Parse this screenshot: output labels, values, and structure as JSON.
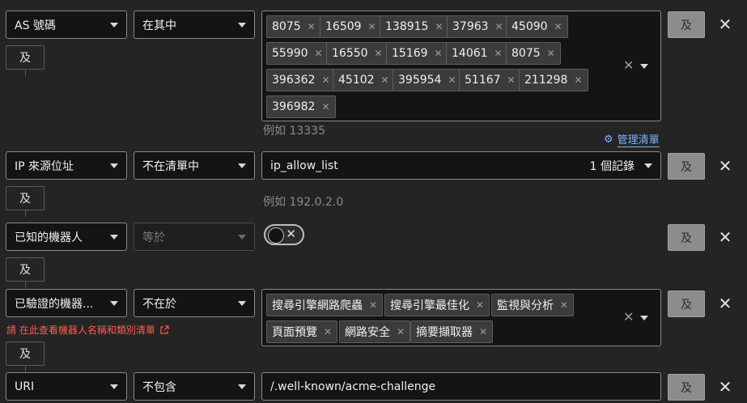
{
  "rows": [
    {
      "field": "AS 號碼",
      "operator": "在其中",
      "tags": [
        "8075",
        "16509",
        "138915",
        "37963",
        "45090",
        "55990",
        "16550",
        "15169",
        "14061",
        "8075",
        "396362",
        "45102",
        "395954",
        "51167",
        "211298",
        "396982"
      ],
      "hint": "例如 13335",
      "manage_link": "管理清單",
      "and_button": "及",
      "and_connector": "及"
    },
    {
      "field": "IP 來源位址",
      "operator": "不在清單中",
      "value": "ip_allow_list",
      "count": "1 個記錄",
      "hint": "例如 192.0.2.0",
      "and_button": "及",
      "and_connector": "及"
    },
    {
      "field": "已知的機器人",
      "operator": "等於",
      "and_button": "及",
      "and_connector": "及"
    },
    {
      "field": "已驗證的機器...",
      "operator": "不在於",
      "tags": [
        "搜尋引擎網路爬蟲",
        "搜尋引擎最佳化",
        "監視與分析",
        "頁面預覽",
        "網路安全",
        "摘要擷取器"
      ],
      "bot_list_link": "請 在此查看機器人名稱和類別清單",
      "and_button": "及",
      "and_connector": "及"
    },
    {
      "field": "URI",
      "operator": "不包含",
      "value": "/.well-known/acme-challenge",
      "and_button": "及"
    }
  ],
  "icons": {
    "remove": "close-icon",
    "clear": "clear-icon",
    "dropdown": "chevron-down-icon",
    "manage": "gear-icon",
    "external": "external-link-icon"
  }
}
